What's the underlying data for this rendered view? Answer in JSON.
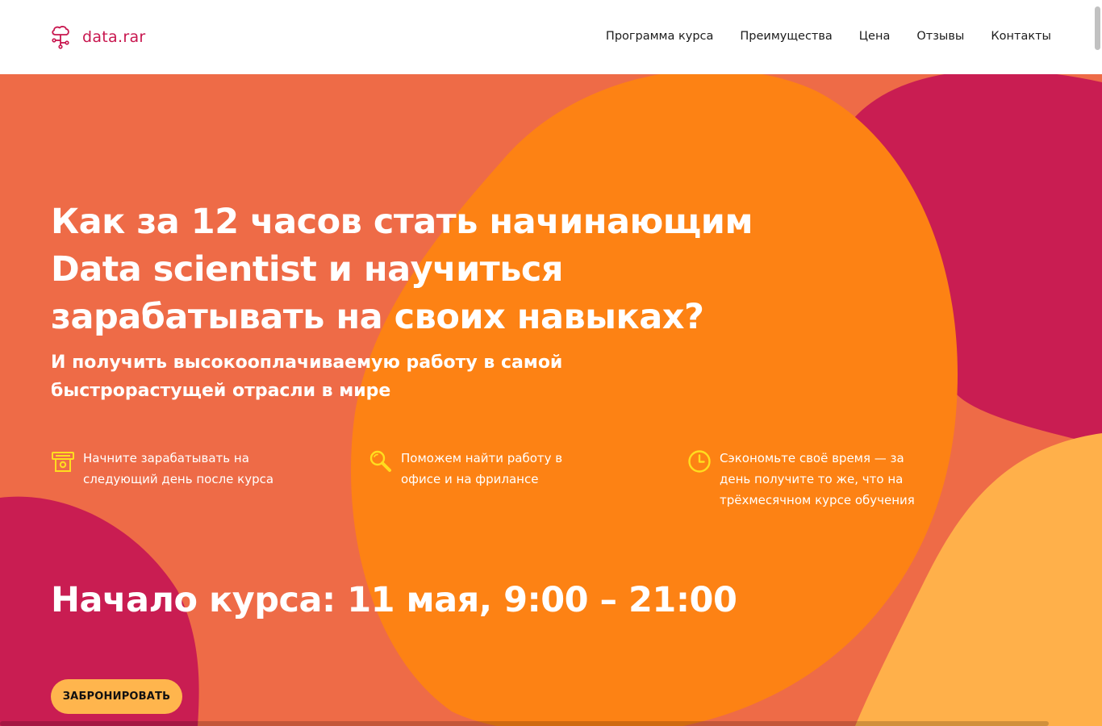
{
  "header": {
    "logo_text": "data.rar",
    "logo_icon": "tree-network-icon",
    "nav": [
      {
        "label": "Программа курса"
      },
      {
        "label": "Преимущества"
      },
      {
        "label": "Цена"
      },
      {
        "label": "Отзывы"
      },
      {
        "label": "Контакты"
      }
    ]
  },
  "hero": {
    "title": "Как за 12 часов стать начинающим Data scientist и научиться зарабатывать на своих навыках?",
    "subtitle": "И получить высокооплачиваемую работу в самой быстрорастущей отрасли в мире",
    "features": [
      {
        "icon": "money-icon",
        "text": "Начните зарабатывать на следующий день после курса"
      },
      {
        "icon": "search-icon",
        "text": "Поможем найти работу в офисе и на фрилансе"
      },
      {
        "icon": "clock-icon",
        "text": "Сэкономьте своё время — за день получите то же, что на трёхмесячном курсе обучения"
      }
    ],
    "course_start": "Начало курса: 11 мая, 9:00 – 21:00",
    "cta_label": "ЗАБРОНИРОВАТЬ"
  },
  "colors": {
    "brand": "#c8174f",
    "hero_bg": "#ee6b47",
    "blob_orange": "#fd8214",
    "blob_crimson": "#c91d52",
    "blob_light_orange": "#ffb04a",
    "icon_yellow": "#ffdd1f",
    "button_bg": "#ffb54d"
  }
}
